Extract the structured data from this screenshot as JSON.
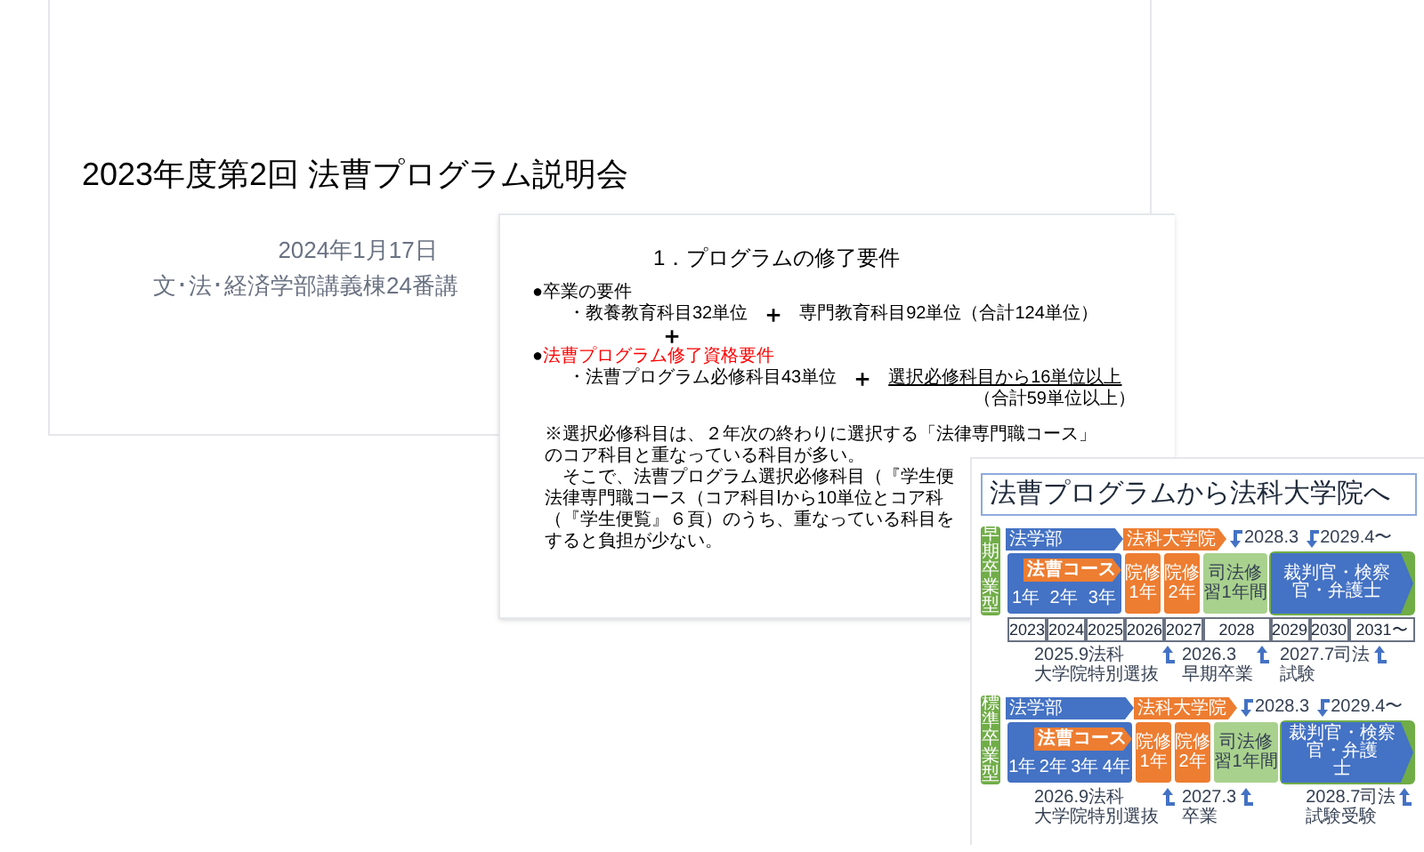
{
  "title_slide": {
    "title": "2023年度第2回 法曹プログラム説明会",
    "date": "2024年1月17日",
    "venue": "文･法･経済学部講義棟24番講"
  },
  "requirements_slide": {
    "heading": "1．プログラムの修了要件",
    "lines": [
      {
        "kind": "bullet",
        "bullet": "●",
        "text": "卒業の要件",
        "emphasis": false
      },
      {
        "kind": "item",
        "left": "・教養教育科目32単位",
        "plus": "＋",
        "right": "専門教育科目92単位（合計124単位）",
        "right_underlined": false
      },
      {
        "kind": "plus",
        "text": "＋"
      },
      {
        "kind": "bullet",
        "bullet": "●",
        "text": "法曹プログラム修了資格要件",
        "emphasis": true
      },
      {
        "kind": "item",
        "left": "・法曹プログラム必修科目43単位",
        "plus": "＋",
        "right": "選択必修科目から16単位以上",
        "right_underlined": true
      },
      {
        "kind": "total",
        "text": "（合計59単位以上）"
      }
    ],
    "note": [
      {
        "text": "※選択必修科目は、２年次の終わりに選択する「法律専門職コース」",
        "indent": false
      },
      {
        "text": "のコア科目と重なっている科目が多い。",
        "indent": false
      },
      {
        "text": "そこで、法曹プログラム選択必修科目（『学生便",
        "indent": true
      },
      {
        "text": "法律専門職コース（コア科目Ⅰから10単位とコア科",
        "indent": false
      },
      {
        "text": "（『学生便覧』６頁）のうち、重なっている科目を",
        "indent": false
      },
      {
        "text": "すると負担が少ない。",
        "indent": false
      }
    ]
  },
  "pathway_slide": {
    "title": "法曹プログラムから法科大学院へ",
    "years": [
      "2023",
      "2024",
      "2025",
      "2026",
      "2027",
      "2028",
      "2029",
      "2030",
      "2031〜"
    ],
    "tracks": [
      {
        "label": "早期卒業型",
        "arrows": [
          {
            "kind": "undergrad",
            "text": "法学部"
          },
          {
            "kind": "graduate",
            "text": "法科大学院"
          }
        ],
        "dates": [
          "2028.3",
          "2029.4〜"
        ],
        "course": "法曹コース",
        "boxes": [
          {
            "kind": "undergrad",
            "lines": [
              "1年"
            ]
          },
          {
            "kind": "undergrad",
            "lines": [
              "2年"
            ]
          },
          {
            "kind": "undergrad",
            "lines": [
              "3年"
            ]
          },
          {
            "kind": "graduate",
            "lines": [
              "院修",
              "1年"
            ]
          },
          {
            "kind": "graduate",
            "lines": [
              "院修",
              "2年"
            ]
          },
          {
            "kind": "training",
            "lines": [
              "司法修",
              "習1年間"
            ]
          },
          {
            "kind": "career",
            "lines": [
              "裁判官・検察官・弁護士"
            ]
          }
        ],
        "notes": [
          {
            "lines": [
              "2025.9法科",
              "大学院特別選抜"
            ]
          },
          {
            "lines": [
              "2026.3",
              "早期卒業"
            ]
          },
          {
            "lines": [
              "2027.7司法",
              "試験"
            ]
          }
        ]
      },
      {
        "label": "標準卒業型",
        "arrows": [
          {
            "kind": "undergrad",
            "text": "法学部"
          },
          {
            "kind": "graduate",
            "text": "法科大学院"
          }
        ],
        "dates": [
          "2028.3",
          "2029.4〜"
        ],
        "course": "法曹コース",
        "boxes": [
          {
            "kind": "undergrad",
            "lines": [
              "1年"
            ]
          },
          {
            "kind": "undergrad",
            "lines": [
              "2年"
            ]
          },
          {
            "kind": "undergrad",
            "lines": [
              "3年"
            ]
          },
          {
            "kind": "undergrad",
            "lines": [
              "4年"
            ]
          },
          {
            "kind": "graduate",
            "lines": [
              "院修",
              "1年"
            ]
          },
          {
            "kind": "graduate",
            "lines": [
              "院修",
              "2年"
            ]
          },
          {
            "kind": "training",
            "lines": [
              "司法修",
              "習1年間"
            ]
          },
          {
            "kind": "career",
            "lines": [
              "裁判官・検察官・弁護",
              "士"
            ]
          }
        ],
        "notes": [
          {
            "lines": [
              "2026.9法科",
              "大学院特別選抜"
            ]
          },
          {
            "lines": [
              "2027.3",
              "卒業"
            ]
          },
          {
            "lines": [
              "2028.7司法",
              "試験受験"
            ]
          }
        ]
      }
    ]
  }
}
